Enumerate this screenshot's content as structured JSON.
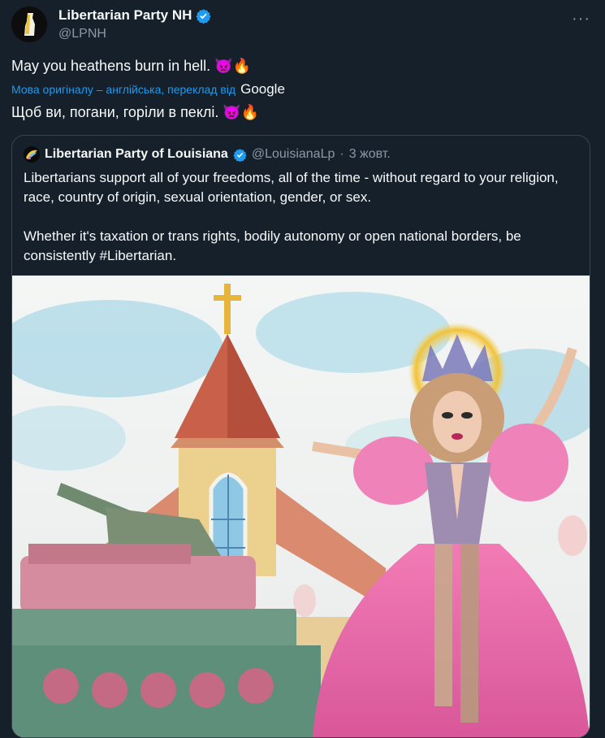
{
  "tweet": {
    "author_name": "Libertarian Party NH",
    "author_handle": "@LPNH",
    "more_label": "···",
    "text": "May you heathens burn in hell.",
    "emojis": "👿🔥",
    "translation_note": "Мова оригіналу – англійська, переклад від",
    "translation_provider": "Google",
    "translated_text": "Щоб ви, погани, горіли в пеклі.",
    "translated_emojis": "👿🔥"
  },
  "quoted": {
    "author_name": "Libertarian Party of Louisiana",
    "author_handle": "@LouisianaLp",
    "separator": "·",
    "date": "3 жовт.",
    "paragraph1": "Libertarians support all of your freedoms, all of the time - without regard to your religion, race, country of origin, sexual orientation, gender, or sex.",
    "paragraph2": "Whether it's taxation or trans rights, bodily autonomy or open national borders, be consistently #Libertarian."
  },
  "colors": {
    "background": "#15202b",
    "link_blue": "#1d9bf0",
    "verified_blue": "#1d9bf0",
    "muted": "#8b98a5",
    "border": "#38444d"
  },
  "icons": [
    "verified-badge-icon",
    "more-options-icon",
    "devil-emoji",
    "fire-emoji"
  ]
}
